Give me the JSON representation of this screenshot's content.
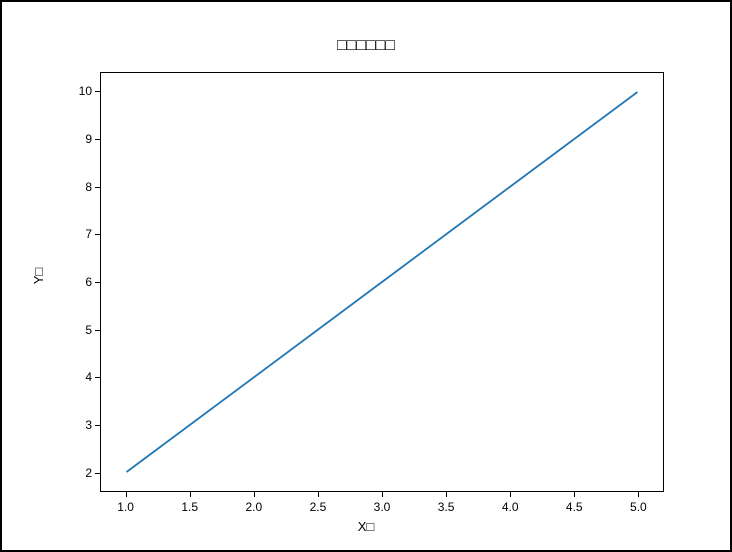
{
  "chart_data": {
    "type": "line",
    "title": "□□□□□□",
    "xlabel": "X□",
    "ylabel": "Y□",
    "x": [
      1,
      2,
      3,
      4,
      5
    ],
    "y": [
      2,
      4,
      6,
      8,
      10
    ],
    "xlim": [
      0.8,
      5.2
    ],
    "ylim": [
      1.6,
      10.4
    ],
    "x_ticks": [
      1.0,
      1.5,
      2.0,
      2.5,
      3.0,
      3.5,
      4.0,
      4.5,
      5.0
    ],
    "x_tick_labels": [
      "1.0",
      "1.5",
      "2.0",
      "2.5",
      "3.0",
      "3.5",
      "4.0",
      "4.5",
      "5.0"
    ],
    "y_ticks": [
      2,
      3,
      4,
      5,
      6,
      7,
      8,
      9,
      10
    ],
    "y_tick_labels": [
      "2",
      "3",
      "4",
      "5",
      "6",
      "7",
      "8",
      "9",
      "10"
    ],
    "line_color": "#1f77b4"
  }
}
